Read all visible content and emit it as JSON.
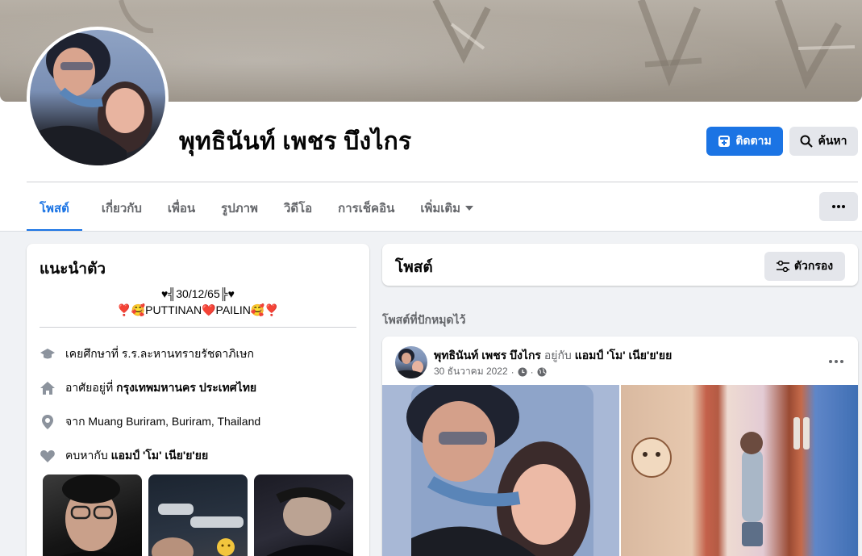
{
  "profile": {
    "name": "พุทธินันท์ เพชร บึงไกร"
  },
  "actions": {
    "follow_label": "ติดตาม",
    "search_label": "ค้นหา"
  },
  "tabs": [
    {
      "label": "โพสต์"
    },
    {
      "label": "เกี่ยวกับ"
    },
    {
      "label": "เพื่อน"
    },
    {
      "label": "รูปภาพ"
    },
    {
      "label": "วิดีโอ"
    },
    {
      "label": "การเช็คอิน"
    },
    {
      "label": "เพิ่มเติม"
    }
  ],
  "intro": {
    "title": "แนะนำตัว",
    "bio_line1": "♥╣30/12/65╠♥",
    "bio_line2": "❣️🥰PUTTINAN❤️PAILIN🥰❣️",
    "education_prefix": "เคยศึกษาที่ ร.ร.ละหานทรายรัชดาภิเษก",
    "lives_prefix": "อาศัยอยู่ที่ ",
    "lives_place": "กรุงเทพมหานคร ประเทศไทย",
    "from_text": "จาก Muang Buriram, Buriram, Thailand",
    "relationship_prefix": "คบหากับ ",
    "relationship_name": "แอมป์ 'โม' เนีย'ย'ยย"
  },
  "posts_section": {
    "title": "โพสต์",
    "filter_label": "ตัวกรอง",
    "pinned_label": "โพสต์ที่ปักหมุดไว้"
  },
  "post": {
    "author": "พุทธินันท์ เพชร บึงไกร",
    "with_text": " อยู่กับ ",
    "tagged": "แอมป์ 'โม' เนีย'ย'ยย",
    "date": "30 ธันวาคม 2022",
    "separator": "·"
  },
  "icons": {
    "follow": "follow-icon",
    "search": "search-icon",
    "more": "more-dots-icon",
    "filter": "filter-icon",
    "education": "graduation-cap-icon",
    "home": "home-icon",
    "location": "location-pin-icon",
    "relationship": "heart-icon",
    "clock": "clock-icon",
    "globe": "globe-icon"
  },
  "colors": {
    "accent": "#1b74e4",
    "text": "#050505",
    "muted": "#65676b",
    "background": "#f0f2f5"
  }
}
